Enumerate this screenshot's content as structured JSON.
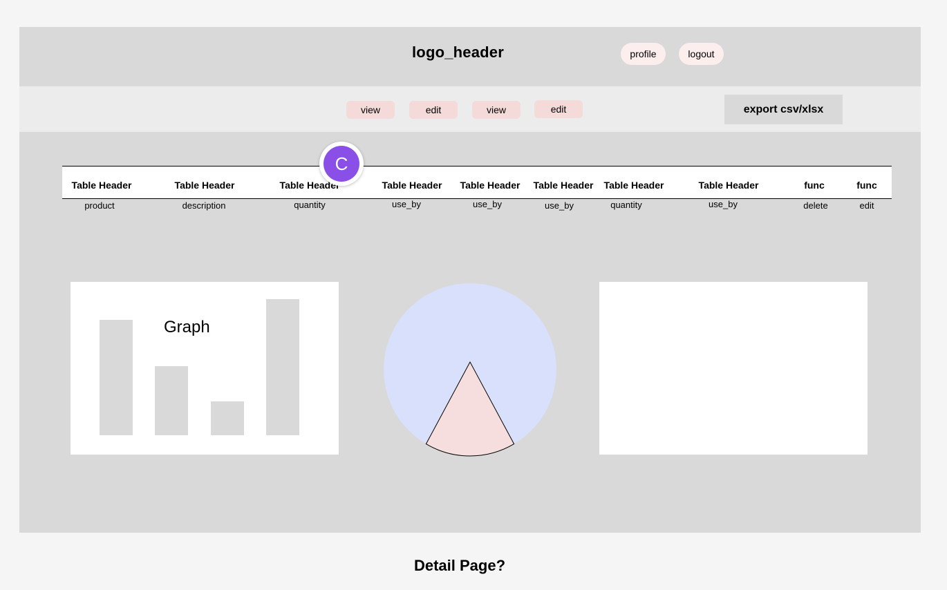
{
  "header": {
    "logo": "logo_header",
    "profile_label": "profile",
    "logout_label": "logout"
  },
  "toolbar": {
    "buttons": [
      "view",
      "edit",
      "view",
      "edit"
    ],
    "export_label": "export csv/xlsx"
  },
  "table": {
    "headers": [
      "Table Header",
      "Table Header",
      "Table Header",
      "Table Header",
      "Table Header",
      "Table Header",
      "Table Header",
      "Table Header",
      "func",
      "func"
    ],
    "row": [
      "product",
      "description",
      "quantity",
      "use_by",
      "use_by",
      "use_by",
      "quantity",
      "use_by",
      "delete",
      "edit"
    ]
  },
  "avatar": {
    "initial": "C",
    "color": "#8a4fe6"
  },
  "graph": {
    "title": "Graph",
    "bars": [
      0.85,
      0.51,
      0.25,
      1.0
    ],
    "bar_color": "#d9d9d9"
  },
  "pie": {
    "background_color": "#d8e0fb",
    "slice_color": "#f7dede",
    "slice_fraction": 0.17
  },
  "footer": {
    "title": "Detail Page?"
  }
}
